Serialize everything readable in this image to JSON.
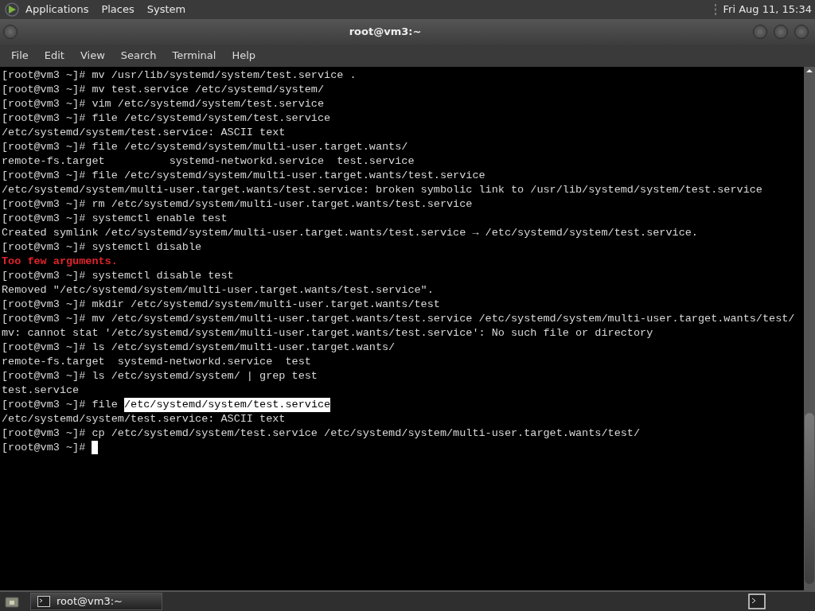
{
  "top_panel": {
    "menus": [
      "Applications",
      "Places",
      "System"
    ],
    "clock": "Fri Aug 11, 15:34"
  },
  "window": {
    "title": "root@vm3:~"
  },
  "menubar": [
    "File",
    "Edit",
    "View",
    "Search",
    "Terminal",
    "Help"
  ],
  "terminal": {
    "lines": [
      {
        "kind": "plain",
        "text": "[root@vm3 ~]# mv /usr/lib/systemd/system/test.service ."
      },
      {
        "kind": "plain",
        "text": "[root@vm3 ~]# mv test.service /etc/systemd/system/"
      },
      {
        "kind": "plain",
        "text": "[root@vm3 ~]# vim /etc/systemd/system/test.service"
      },
      {
        "kind": "plain",
        "text": "[root@vm3 ~]# file /etc/systemd/system/test.service"
      },
      {
        "kind": "plain",
        "text": "/etc/systemd/system/test.service: ASCII text"
      },
      {
        "kind": "plain",
        "text": "[root@vm3 ~]# file /etc/systemd/system/multi-user.target.wants/"
      },
      {
        "kind": "plain",
        "text": "remote-fs.target          systemd-networkd.service  test.service"
      },
      {
        "kind": "plain",
        "text": "[root@vm3 ~]# file /etc/systemd/system/multi-user.target.wants/test.service"
      },
      {
        "kind": "plain",
        "text": "/etc/systemd/system/multi-user.target.wants/test.service: broken symbolic link to /usr/lib/systemd/system/test.service"
      },
      {
        "kind": "plain",
        "text": "[root@vm3 ~]# rm /etc/systemd/system/multi-user.target.wants/test.service"
      },
      {
        "kind": "plain",
        "text": "[root@vm3 ~]# systemctl enable test"
      },
      {
        "kind": "plain",
        "text": "Created symlink /etc/systemd/system/multi-user.target.wants/test.service → /etc/systemd/system/test.service."
      },
      {
        "kind": "plain",
        "text": "[root@vm3 ~]# systemctl disable"
      },
      {
        "kind": "error",
        "text": "Too few arguments."
      },
      {
        "kind": "plain",
        "text": "[root@vm3 ~]# systemctl disable test"
      },
      {
        "kind": "plain",
        "text": "Removed \"/etc/systemd/system/multi-user.target.wants/test.service\"."
      },
      {
        "kind": "plain",
        "text": "[root@vm3 ~]# mkdir /etc/systemd/system/multi-user.target.wants/test"
      },
      {
        "kind": "plain",
        "text": "[root@vm3 ~]# mv /etc/systemd/system/multi-user.target.wants/test.service /etc/systemd/system/multi-user.target.wants/test/"
      },
      {
        "kind": "plain",
        "text": "mv: cannot stat '/etc/systemd/system/multi-user.target.wants/test.service': No such file or directory"
      },
      {
        "kind": "plain",
        "text": "[root@vm3 ~]# ls /etc/systemd/system/multi-user.target.wants/"
      },
      {
        "kind": "plain",
        "text": "remote-fs.target  systemd-networkd.service  test"
      },
      {
        "kind": "plain",
        "text": "[root@vm3 ~]# ls /etc/systemd/system/ | grep test"
      },
      {
        "kind": "plain",
        "text": "test.service"
      },
      {
        "kind": "parts",
        "parts": [
          {
            "text": "[root@vm3 ~]# file ",
            "selected": false
          },
          {
            "text": "/etc/systemd/system/test.service",
            "selected": true
          }
        ]
      },
      {
        "kind": "plain",
        "text": "/etc/systemd/system/test.service: ASCII text"
      },
      {
        "kind": "plain",
        "text": "[root@vm3 ~]# cp /etc/systemd/system/test.service /etc/systemd/system/multi-user.target.wants/test/"
      },
      {
        "kind": "cursor",
        "text": "[root@vm3 ~]# "
      }
    ]
  },
  "taskbar": {
    "tasks": [
      {
        "label": "root@vm3:~",
        "selected": true
      }
    ]
  }
}
